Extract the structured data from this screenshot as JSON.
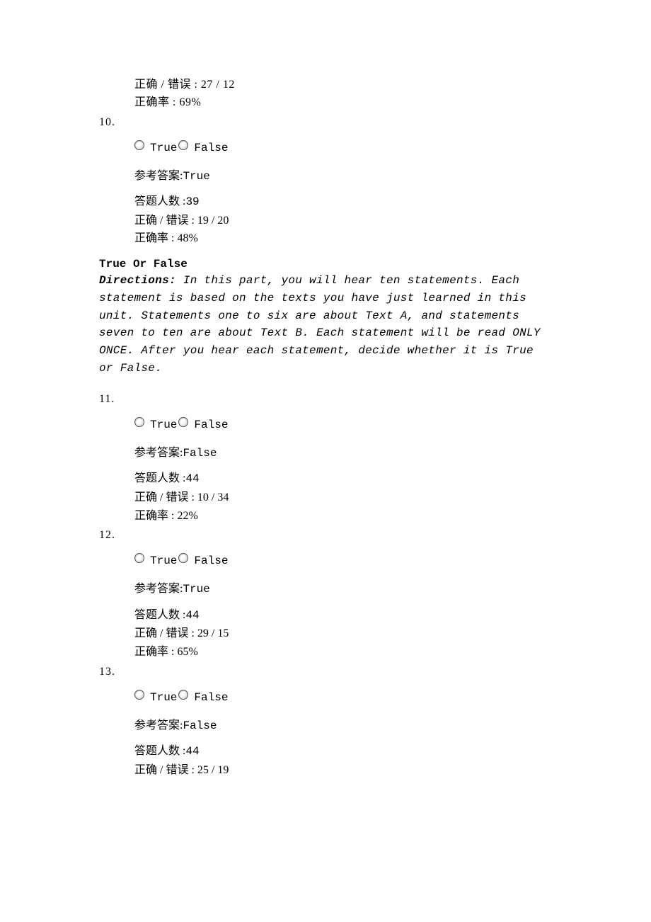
{
  "labels": {
    "correct_wrong_prefix": "正确 / 错误 : ",
    "rate_prefix": "正确率 : ",
    "answer_prefix": "参考答案:",
    "count_prefix": "答题人数 :",
    "option_true": "True",
    "option_false": "False"
  },
  "top_partial": {
    "correct_wrong": "27 / 12",
    "rate": "69%"
  },
  "q10": {
    "number": "10.",
    "answer": "True",
    "count": "39",
    "correct_wrong": "19 / 20",
    "rate": "48%"
  },
  "section": {
    "title": "True Or False",
    "directions_label": "Directions:",
    "directions_text": " In this part, you will hear ten statements. Each statement is based on the texts you have just learned in this unit. Statements one to six are about Text A, and statements seven to ten are about Text B. Each statement will be read ONLY ONCE. After you hear each statement, decide whether it is True or False."
  },
  "q11": {
    "number": "11.",
    "answer": "False",
    "count": "44",
    "correct_wrong": "10 / 34",
    "rate": "22%"
  },
  "q12": {
    "number": "12.",
    "answer": "True",
    "count": "44",
    "correct_wrong": "29 / 15",
    "rate": "65%"
  },
  "q13": {
    "number": "13.",
    "answer": "False",
    "count": "44",
    "correct_wrong": "25 / 19"
  }
}
